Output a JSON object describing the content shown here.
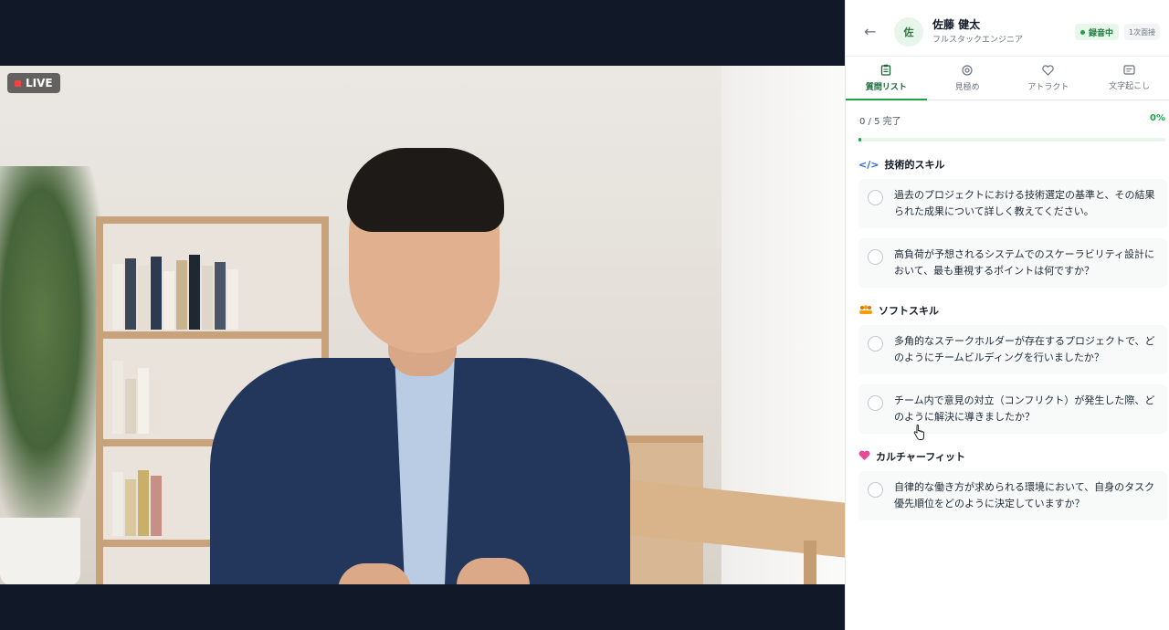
{
  "video": {
    "live_label": "LIVE"
  },
  "header": {
    "avatar_initial": "佐",
    "candidate_name": "佐藤 健太",
    "candidate_role": "フルスタックエンジニア",
    "recording_label": "録音中",
    "stage_label": "1次面接"
  },
  "tabs": [
    {
      "label": "質問リスト",
      "icon": "clipboard-icon",
      "active": true
    },
    {
      "label": "見極め",
      "icon": "target-icon",
      "active": false
    },
    {
      "label": "アトラクト",
      "icon": "heart-icon",
      "active": false
    },
    {
      "label": "文字起こし",
      "icon": "transcript-icon",
      "active": false
    }
  ],
  "progress": {
    "text": "0 / 5 完了",
    "percent_label": "0%",
    "fraction": 0
  },
  "sections": [
    {
      "title": "技術的スキル",
      "icon": "</>",
      "questions": [
        "過去のプロジェクトにおける技術選定の基準と、その結果られた成果について詳しく教えてください。",
        "高負荷が予想されるシステムでのスケーラビリティ設計において、最も重視するポイントは何ですか？"
      ]
    },
    {
      "title": "ソフトスキル",
      "icon": "people-icon",
      "questions": [
        "多角的なステークホルダーが存在するプロジェクトで、どのようにチームビルディングを行いましたか？",
        "チーム内で意見の対立（コンフリクト）が発生した際、どのように解決に導きましたか？"
      ]
    },
    {
      "title": "カルチャーフィット",
      "icon": "heart-icon",
      "questions": [
        "自律的な働き方が求められる環境において、自身のタスク優先順位をどのように決定していますか？"
      ]
    }
  ],
  "colors": {
    "accent": "#22a045",
    "accent_dark": "#166534",
    "live_dot": "#ef4444",
    "culture_heart": "#ec4899",
    "soft_skill_icon": "#d97706",
    "tech_icon": "#2563eb"
  }
}
